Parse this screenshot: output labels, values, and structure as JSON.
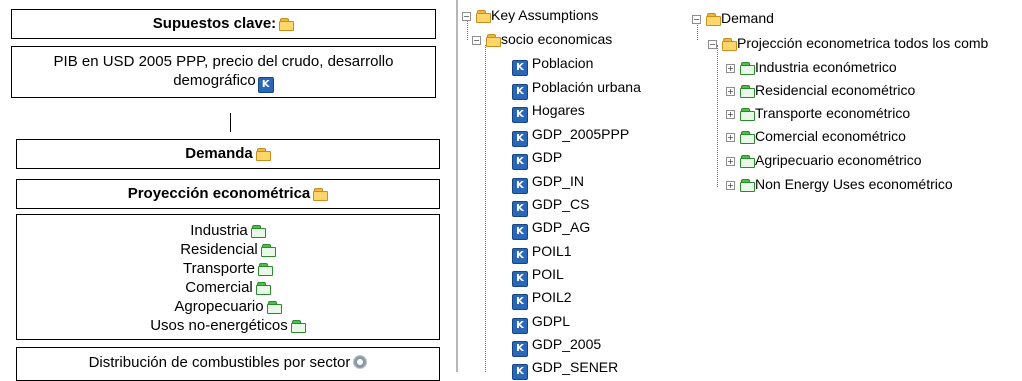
{
  "diagram": {
    "supuestos": {
      "label": "Supuestos clave:"
    },
    "pib": {
      "line1": "PIB en USD 2005 PPP, precio del crudo, desarrollo",
      "line2": "demográfico"
    },
    "demanda": {
      "label": "Demanda"
    },
    "proyeccion": {
      "label": "Proyección econométrica"
    },
    "sectors": [
      "Industria",
      "Residencial",
      "Transporte",
      "Comercial",
      "Agropecuario",
      "Usos no-energéticos"
    ],
    "distribucion": {
      "label": "Distribución de combustibles por sector"
    }
  },
  "tree_left": {
    "root": "Key Assumptions",
    "group": "socio economicas",
    "items": [
      "Poblacion",
      "Población urbana",
      "Hogares",
      "GDP_2005PPP",
      "GDP",
      "GDP_IN",
      "GDP_CS",
      "GDP_AG",
      "POIL1",
      "POIL",
      "POIL2",
      "GDPL",
      "GDP_2005",
      "GDP_SENER"
    ]
  },
  "tree_right": {
    "root": "Demand",
    "group": "Projección econometrica todos los comb",
    "items": [
      "Industria económetrico",
      "Residencial econométrico",
      "Transporte econométrico",
      "Comercial econométrico",
      "Agripecuario econométrico",
      "Non Energy Uses econométrico"
    ]
  },
  "icons": {
    "k_letter": "K",
    "folder_yellow": "folder-icon",
    "folder_green": "folder-green-icon",
    "gear": "gear-icon"
  }
}
